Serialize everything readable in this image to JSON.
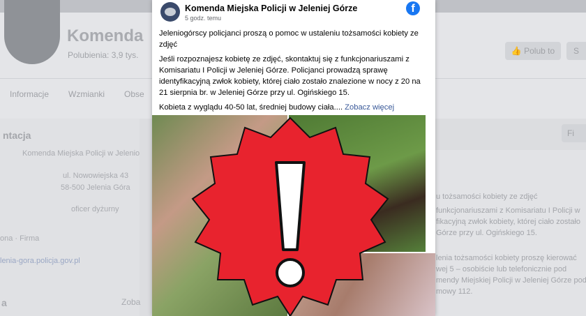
{
  "background": {
    "page_name": "Komenda",
    "likes": "Polubienia: 3,9 tys.",
    "like_button": "Polub to",
    "search_button": "S",
    "tabs": [
      "Informacje",
      "Wzmianki",
      "Obse"
    ],
    "left_section_title": "ntacja",
    "left_lines": [
      "Komenda Miejska Policji w Jelenio",
      "ul. Nowowiejska 43",
      "58-500 Jelenia Góra",
      "oficer dyżurny",
      "ona · Firma",
      "lenia-gora.policja.gov.pl",
      "a",
      "Zoba"
    ],
    "right_button": "Fi",
    "right_lines": [
      "u tożsamości kobiety ze zdjęć",
      "funkcjonariuszami z Komisariatu I Policji w",
      "fikacyjną zwłok kobiety, której ciało zostało",
      "Górze przy ul. Ogińskiego 15.",
      "lenia tożsamości kobiety proszę kierować",
      "wej 5 – osobiście lub telefonicznie pod",
      "mendy Miejskiej Policji w Jeleniej Górze pod",
      "mowy 112."
    ]
  },
  "post": {
    "author": "Komenda Miejska Policji w Jeleniej Górze",
    "time": "5 godz. temu",
    "platform_icon": "facebook-icon",
    "paragraph1": "Jeleniogórscy policjanci proszą o pomoc w ustaleniu tożsamości kobiety ze zdjęć",
    "paragraph2": "Jeśli rozpoznajesz kobietę ze zdjęć, skontaktuj się z funkcjonariuszami z Komisariatu I Policji w Jeleniej Górze. Policjanci prowadzą sprawę identyfikacyjną zwłok kobiety, której ciało zostało znalezione w nocy z 20 na 21 sierpnia br. w Jeleniej Górze przy ul. Ogińskiego 15.",
    "paragraph3": "Kobieta z wyglądu 40-50 lat, średniej budowy ciała....",
    "see_more": "Zobacz więcej"
  },
  "overlay": {
    "icon": "warning-exclamation-icon",
    "color": "#e8232e"
  }
}
